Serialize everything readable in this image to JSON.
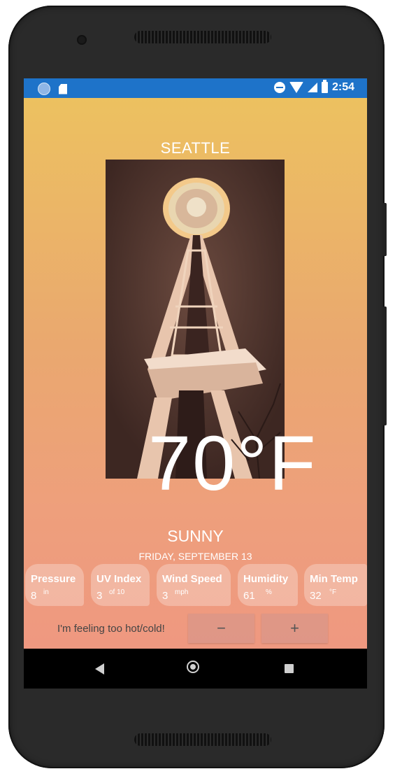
{
  "status_bar": {
    "time": "2:54",
    "icons": [
      "notification-circle-icon",
      "sd-card-icon",
      "do-not-disturb-icon",
      "wifi-icon",
      "signal-icon",
      "battery-icon"
    ],
    "color": "#1e73c9"
  },
  "weather": {
    "city": "SEATTLE",
    "temperature": "70°F",
    "condition": "SUNNY",
    "date": "FRIDAY, SEPTEMBER 13"
  },
  "stats": [
    {
      "label": "Pressure",
      "value": "8",
      "unit": "in"
    },
    {
      "label": "UV Index",
      "value": "3",
      "unit": "of 10"
    },
    {
      "label": "Wind Speed",
      "value": "3",
      "unit": "mph"
    },
    {
      "label": "Humidity",
      "value": "61",
      "unit": "%"
    },
    {
      "label": "Min Temp",
      "value": "32",
      "unit": "°F"
    }
  ],
  "feeling": {
    "text": "I'm feeling too hot/cold!",
    "minus_label": "−",
    "plus_label": "+"
  },
  "nav_bar": {
    "icons": [
      "back-icon",
      "home-icon",
      "recents-icon"
    ]
  },
  "theme": {
    "gradient_top": "#ecc160",
    "gradient_bottom": "#ef9880",
    "card_bg": "rgba(255,255,255,0.28)"
  }
}
